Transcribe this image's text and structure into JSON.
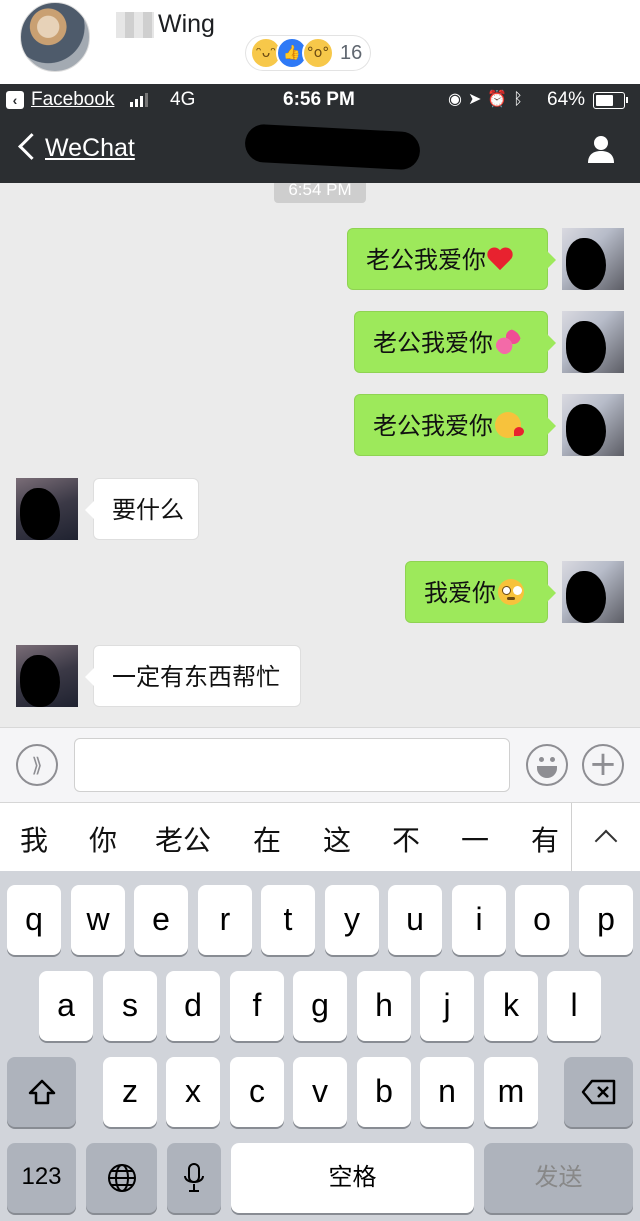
{
  "facebook_post": {
    "author_name": "Wing",
    "reactions": [
      "laughing-emoji",
      "like-thumb",
      "wow-emoji"
    ],
    "reaction_count": "16"
  },
  "status_bar": {
    "back_app": "Facebook",
    "network": "4G",
    "time": "6:56 PM",
    "icons": [
      "lock-rotation-icon",
      "location-icon",
      "alarm-icon",
      "bluetooth-icon"
    ],
    "battery_percent": "64%",
    "battery_level": 0.64
  },
  "nav": {
    "back_label": "WeChat",
    "profile_icon": "person-icon"
  },
  "chat": {
    "timestamp": "6:54 PM",
    "messages": [
      {
        "side": "sent",
        "text": "老公我爱你",
        "emoji": "red-heart"
      },
      {
        "side": "sent",
        "text": "老公我爱你",
        "emoji": "two-hearts"
      },
      {
        "side": "sent",
        "text": "老公我爱你",
        "emoji": "face-blowing-kiss"
      },
      {
        "side": "received",
        "text": "要什么",
        "emoji": ""
      },
      {
        "side": "sent",
        "text": "我爱你",
        "emoji": "flushed-face"
      },
      {
        "side": "received",
        "text": "一定有东西帮忙",
        "emoji": ""
      }
    ]
  },
  "input_bar": {
    "voice_icon": "voice-icon",
    "emoji_icon": "emoji-smiley-icon",
    "plus_icon": "plus-icon",
    "input_value": ""
  },
  "candidates": [
    "我",
    "你",
    "老公",
    "在",
    "这",
    "不",
    "一",
    "有"
  ],
  "keyboard": {
    "row1": [
      "q",
      "w",
      "e",
      "r",
      "t",
      "y",
      "u",
      "i",
      "o",
      "p"
    ],
    "row2": [
      "a",
      "s",
      "d",
      "f",
      "g",
      "h",
      "j",
      "k",
      "l"
    ],
    "row3": [
      "z",
      "x",
      "c",
      "v",
      "b",
      "n",
      "m"
    ],
    "numbers_label": "123",
    "space_label": "空格",
    "send_label": "发送"
  }
}
